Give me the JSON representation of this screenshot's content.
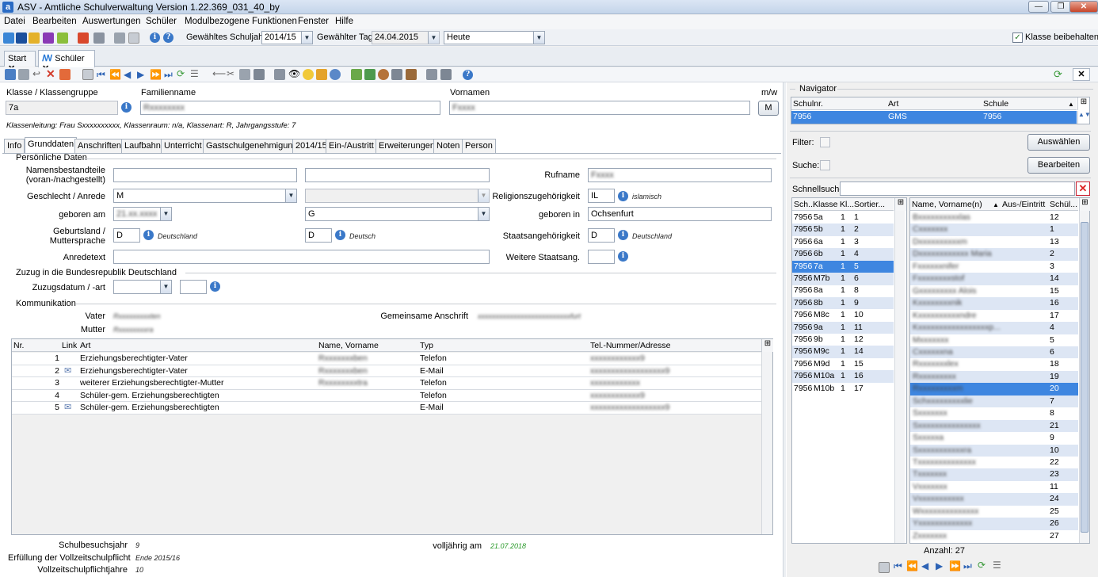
{
  "window": {
    "title": "ASV - Amtliche Schulverwaltung Version 1.22.369_031_40_by",
    "min": "—",
    "max": "❐",
    "close": "✕"
  },
  "menu": [
    "Datei",
    "Bearbeiten",
    "Auswertungen",
    "Schüler",
    "Modulbezogene Funktionen",
    "Fenster",
    "Hilfe"
  ],
  "toolbar": {
    "schuljahr_label": "Gewähltes Schuljahr",
    "schuljahr": "2014/15",
    "tag_label": "Gewählter Tag",
    "tag": "24.04.2015",
    "heute": "Heute",
    "klasse_beibehalten": "Klasse beibehalten"
  },
  "doctabs": [
    "Start",
    "Schüler"
  ],
  "header": {
    "klasse_label": "Klasse / Klassengruppe",
    "klasse": "7a",
    "familienname_label": "Familienname",
    "familienname": "Rxxxxxxxx",
    "vornamen_label": "Vornamen",
    "vornamen": "Fxxxx",
    "mw_label": "m/w",
    "mw": "M",
    "klassenleitung": "Klassenleitung: Frau Sxxxxxxxxxx, Klassenraum: n/a, Klassenart: R, Jahrgangsstufe: 7"
  },
  "tabs": [
    "Info",
    "Grunddaten",
    "Anschriften",
    "Laufbahn",
    "Unterricht",
    "Gastschulgenehmigung",
    "2014/15",
    "Ein-/Austritt",
    "Erweiterungen",
    "Noten",
    "Person"
  ],
  "pd": {
    "section": "Persönliche Daten",
    "namens_label": "Namensbestandteile\n(voran-/nachgestellt)",
    "rufname_label": "Rufname",
    "rufname": "Fxxxx",
    "geschlecht_label": "Geschlecht / Anrede",
    "geschlecht": "M",
    "religion_label": "Religionszugehörigkeit",
    "religion": "IL",
    "religion_hint": "islamisch",
    "geboren_label": "geboren am",
    "geboren": "21.xx.xxxx",
    "geb_g": "G",
    "geboren_in_label": "geboren in",
    "geboren_in": "Ochsenfurt",
    "geburtsland_label": "Geburtsland /\nMuttersprache",
    "geburtsland": "D",
    "geburtsland_hint": "Deutschland",
    "mutter": "D",
    "mutter_hint": "Deutsch",
    "staat_label": "Staatsangehörigkeit",
    "staat": "D",
    "staat_hint": "Deutschland",
    "anrede_label": "Anredetext",
    "weitere_label": "Weitere Staatsang."
  },
  "zuzug": {
    "section": "Zuzug in die Bundesrepublik Deutschland",
    "label": "Zuzugsdatum / -art"
  },
  "komm": {
    "section": "Kommunikation",
    "vater_label": "Vater",
    "vater": "Rxxxxxxxxxten",
    "mutter_label": "Mutter",
    "mutter": "Rxxxxxxxxra",
    "gem_label": "Gemeinsame Anschrift",
    "gem": "xxxxxxxxxxxxxxxxxxxxxxxxxxfurt",
    "cols": [
      "Nr.",
      "Link",
      "Art",
      "Name, Vorname",
      "Typ",
      "Tel.-Nummer/Adresse"
    ],
    "rows": [
      {
        "nr": "1",
        "art": "Erziehungsberechtigter-Vater",
        "name": "Rxxxxxxxben",
        "typ": "Telefon",
        "tel": "xxxxxxxxxxxx9",
        "mail": false
      },
      {
        "nr": "2",
        "art": "Erziehungsberechtigter-Vater",
        "name": "Rxxxxxxxben",
        "typ": "E-Mail",
        "tel": "xxxxxxxxxxxxxxxxxx9",
        "mail": true
      },
      {
        "nr": "3",
        "art": "weiterer Erziehungsberechtigter-Mutter",
        "name": "Rxxxxxxxxtra",
        "typ": "Telefon",
        "tel": "xxxxxxxxxxxx",
        "mail": false
      },
      {
        "nr": "4",
        "art": "Schüler-gem. Erziehungsberechtigten",
        "name": "",
        "typ": "Telefon",
        "tel": "xxxxxxxxxxxx9",
        "mail": false
      },
      {
        "nr": "5",
        "art": "Schüler-gem. Erziehungsberechtigten",
        "name": "",
        "typ": "E-Mail",
        "tel": "xxxxxxxxxxxxxxxxxx9",
        "mail": true
      }
    ]
  },
  "footer": {
    "schulbesuch_label": "Schulbesuchsjahr",
    "schulbesuch": "9",
    "erfuellung_label": "Erfüllung der Vollzeitschulpflicht",
    "erfuellung": "Ende 2015/16",
    "vollzeit_label": "Vollzeitschulpflichtjahre",
    "vollzeit": "10",
    "volljaehrig_label": "volljährig am",
    "volljaehrig": "21.07.2018"
  },
  "nav": {
    "title": "Navigator",
    "cols": [
      "Schulnr.",
      "Art",
      "Schule"
    ],
    "row": [
      "7956",
      "GMS",
      "7956"
    ],
    "filter_label": "Filter:",
    "suche_label": "Suche:",
    "auswaehlen": "Auswählen",
    "bearbeiten": "Bearbeiten",
    "schnellsuche_label": "Schnellsuche",
    "kcols": [
      "Sch...",
      "Klasse",
      "Kl...",
      "Sortier..."
    ],
    "klassen": [
      [
        "7956",
        "5a",
        "1",
        "1"
      ],
      [
        "7956",
        "5b",
        "1",
        "2"
      ],
      [
        "7956",
        "6a",
        "1",
        "3"
      ],
      [
        "7956",
        "6b",
        "1",
        "4"
      ],
      [
        "7956",
        "7a",
        "1",
        "5"
      ],
      [
        "7956",
        "M7b",
        "1",
        "6"
      ],
      [
        "7956",
        "8a",
        "1",
        "8"
      ],
      [
        "7956",
        "8b",
        "1",
        "9"
      ],
      [
        "7956",
        "M8c",
        "1",
        "10"
      ],
      [
        "7956",
        "9a",
        "1",
        "11"
      ],
      [
        "7956",
        "9b",
        "1",
        "12"
      ],
      [
        "7956",
        "M9c",
        "1",
        "14"
      ],
      [
        "7956",
        "M9d",
        "1",
        "15"
      ],
      [
        "7956",
        "M10a",
        "1",
        "16"
      ],
      [
        "7956",
        "M10b",
        "1",
        "17"
      ]
    ],
    "scols": [
      "Name, Vorname(n)",
      "Aus-/Eintritt",
      "Schül..."
    ],
    "schueler": [
      [
        "Bxxxxxxxxxxlas",
        "12"
      ],
      [
        "Cxxxxxxx",
        "1"
      ],
      [
        "Dxxxxxxxxxxm",
        "13"
      ],
      [
        "Dxxxxxxxxxxxx Maria",
        "2"
      ],
      [
        "Fxxxxxxnifer",
        "3"
      ],
      [
        "Fxxxxxxxxstof",
        "14"
      ],
      [
        "Gxxxxxxxxx Alois",
        "15"
      ],
      [
        "Kxxxxxxxxnik",
        "16"
      ],
      [
        "Kxxxxxxxxxxndre",
        "17"
      ],
      [
        "Kxxxxxxxxxxxxxxxxxp...",
        "4"
      ],
      [
        "Mxxxxxxx",
        "5"
      ],
      [
        "Cxxxxxxna",
        "6"
      ],
      [
        "Rxxxxxxxlex",
        "18"
      ],
      [
        "Rxxxxxxxxx",
        "19"
      ],
      [
        "Rxxxxxxxxxm",
        "20"
      ],
      [
        "Schxxxxxxxxxlie",
        "7"
      ],
      [
        "Sxxxxxxx",
        "8"
      ],
      [
        "Sxxxxxxxxxxxxxxx",
        "21"
      ],
      [
        "Sxxxxxa",
        "9"
      ],
      [
        "Sxxxxxxxxxxxra",
        "10"
      ],
      [
        "Txxxxxxxxxxxxxx",
        "22"
      ],
      [
        "Txxxxxxx",
        "23"
      ],
      [
        "Vxxxxxxx",
        "11"
      ],
      [
        "Vxxxxxxxxxxx",
        "24"
      ],
      [
        "Wxxxxxxxxxxxxxx",
        "25"
      ],
      [
        "Yxxxxxxxxxxxxx",
        "26"
      ],
      [
        "Zxxxxxxx",
        "27"
      ]
    ],
    "anzahl": "Anzahl: 27"
  }
}
